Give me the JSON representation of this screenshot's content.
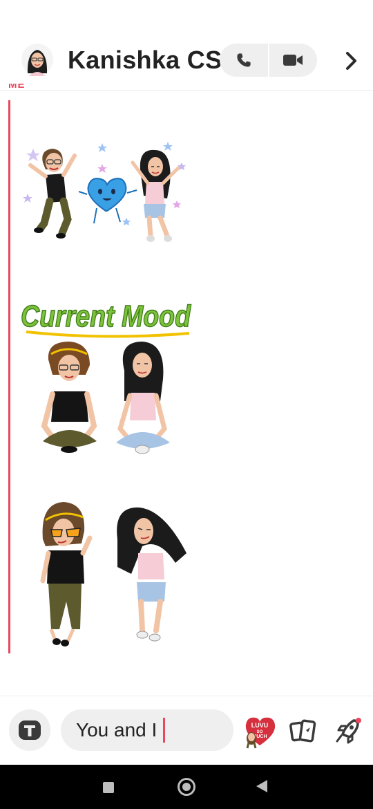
{
  "header": {
    "contact_name": "Kanishka CS"
  },
  "chat": {
    "sender_label": "ME"
  },
  "composer": {
    "input_value": "You and I"
  },
  "stickers": {
    "mood_text": "Current Mood",
    "heart_text_1": "LUVU",
    "heart_text_2": "SO",
    "heart_text_3": "MUCH"
  },
  "colors": {
    "accent": "#e8475d",
    "icon": "#3a3a3a",
    "pill": "#efefef"
  },
  "icons": [
    "phone-icon",
    "video-icon",
    "chevron-right-icon",
    "text-t-icon",
    "cards-icon",
    "rocket-icon"
  ]
}
